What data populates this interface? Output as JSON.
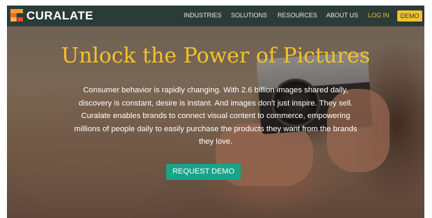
{
  "nav": {
    "brand": "CURALATE",
    "links": [
      "INDUSTRIES",
      "SOLUTIONS",
      "RESOURCES",
      "ABOUT US"
    ],
    "login": "LOG IN",
    "demo": "DEMO"
  },
  "hero": {
    "headline": "Unlock the Power of Pictures",
    "lines": [
      "Consumer behavior is rapidly changing. With 2.6 billion images shared daily,",
      "discovery is constant, desire is instant. And images don’t just inspire. They sell.",
      "Curalate enables brands to connect visual content to commerce, empowering",
      "millions of people daily to easily purchase the products they want from the brands",
      "they love."
    ],
    "cta": "REQUEST DEMO"
  },
  "colors": {
    "nav_bg": "#2a3b38",
    "accent_yellow": "#f3c22c",
    "cta_green": "#17a58a"
  }
}
